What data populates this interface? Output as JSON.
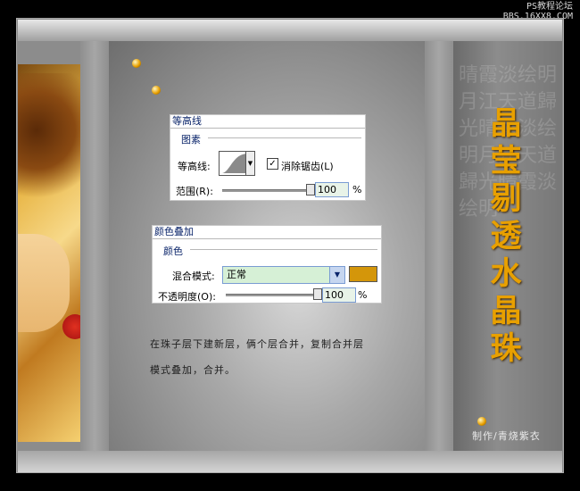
{
  "watermark": {
    "line1": "PS教程论坛",
    "line2": "BBS.16XX8.COM"
  },
  "contour_dialog": {
    "title": "等高线",
    "group": "图素",
    "contour_label": "等高线:",
    "antialias_label": "消除锯齿(L)",
    "antialias_checked": true,
    "range_label": "范围(R):",
    "range_value": "100",
    "range_unit": "%",
    "range_level_percent": 100
  },
  "color_overlay_dialog": {
    "title": "颜色叠加",
    "group": "颜色",
    "blend_label": "混合模式:",
    "blend_value": "正常",
    "opacity_label": "不透明度(O):",
    "opacity_value": "100",
    "opacity_unit": "%",
    "opacity_level_percent": 100,
    "swatch_color": "#d4960a"
  },
  "notes": {
    "line1": "在珠子层下建新层，俩个层合并，复制合并层",
    "line2": "模式叠加，合并。"
  },
  "side_title": [
    "晶",
    "莹",
    "剔",
    "透",
    "水",
    "晶",
    "珠"
  ],
  "credit": "制作/青烧紫衣",
  "colors": {
    "title_gold": "#e8a000",
    "dialog_title": "#0a246a",
    "select_bg": "#d6f0d6"
  },
  "icons": [
    "gold-bead-icon",
    "checkbox-check-icon",
    "dropdown-arrow-icon",
    "contour-curve-icon",
    "slider-thumb-icon"
  ]
}
